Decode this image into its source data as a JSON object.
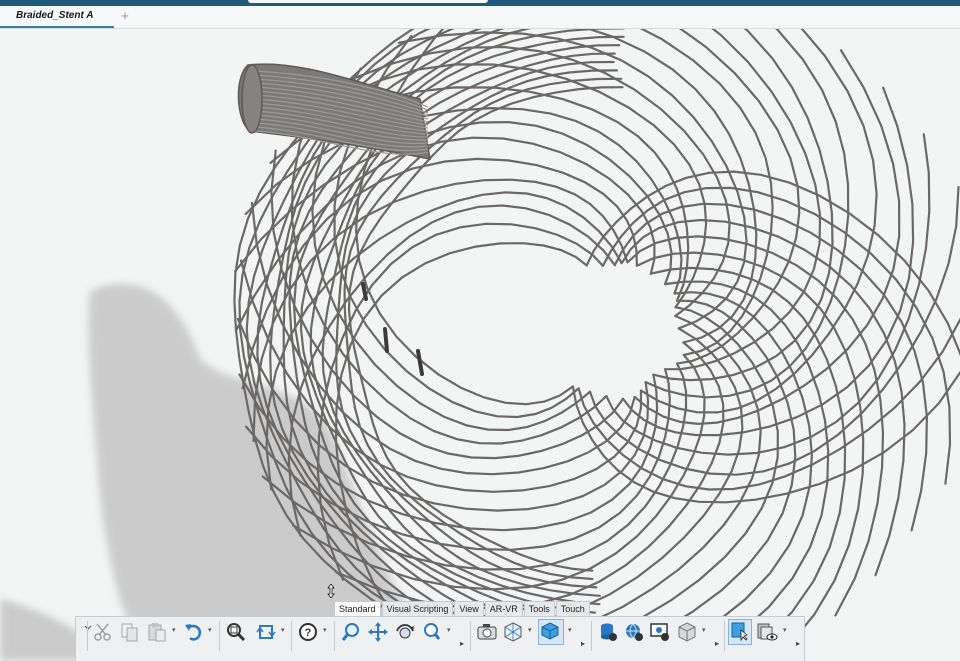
{
  "window": {
    "accent": "#1e5a7a"
  },
  "tabs": {
    "active_document": "Braided_Stent A",
    "add_tab": "+"
  },
  "viewport": {
    "model": "braided stent wireframe",
    "wire_color": "#6b6968",
    "background": "#f3f4f4"
  },
  "command_manager": {
    "tabs": [
      {
        "label": "Standard",
        "active": true
      },
      {
        "label": "Visual Scripting",
        "active": false
      },
      {
        "label": "View",
        "active": false
      },
      {
        "label": "AR-VR",
        "active": false
      },
      {
        "label": "Tools",
        "active": false
      },
      {
        "label": "Touch",
        "active": false
      }
    ],
    "icons": [
      "collapse-chevron-icon",
      "cut-icon",
      "copy-icon",
      "paste-icon",
      "undo-icon",
      "zoom-fit-icon",
      "rotate-view-icon",
      "help-icon",
      "zoom-icon",
      "move-icon",
      "orbit-icon",
      "search-icon",
      "screenshot-icon",
      "view-orientation-icon",
      "display-style-icon",
      "database-icon",
      "globe-icon",
      "monitor-icon",
      "geometry-icon",
      "select-window-icon",
      "view-visibility-icon"
    ]
  }
}
